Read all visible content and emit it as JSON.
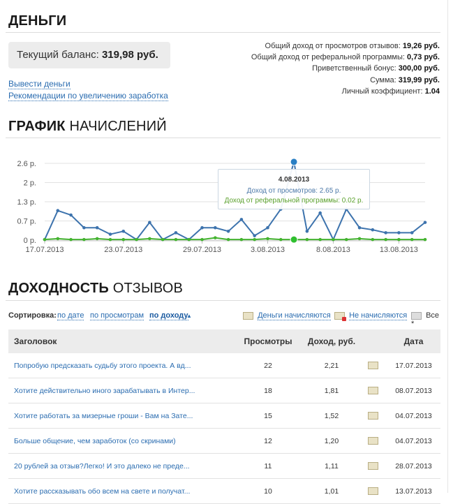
{
  "money": {
    "title": "ДЕНЬГИ",
    "balance_label": "Текущий баланс:",
    "balance_value": "319,98 руб.",
    "links": [
      "Вывести деньги",
      "Рекомендации по увеличению заработка"
    ],
    "summary": [
      {
        "label": "Общий доход от просмотров отзывов:",
        "value": "19,26 руб."
      },
      {
        "label": "Общий доход от реферальной программы:",
        "value": "0,73 руб."
      },
      {
        "label": "Приветственный бонус:",
        "value": "300,00 руб."
      },
      {
        "label": "Сумма:",
        "value": "319,99 руб."
      },
      {
        "label": "Личный коэффициент:",
        "value": "1.04"
      }
    ]
  },
  "chart_section": {
    "title_bold": "ГРАФИК",
    "title_rest": " НАЧИСЛЕНИЙ"
  },
  "chart_data": {
    "type": "line",
    "y_ticks": [
      "0 р.",
      "0.7 р.",
      "1.3 р.",
      "2 р.",
      "2.6 р."
    ],
    "y_tick_values": [
      0,
      0.65,
      1.3,
      1.95,
      2.6
    ],
    "ylim": [
      0,
      2.6
    ],
    "x_tick_labels": [
      {
        "index": 0,
        "label": "17.07.2013"
      },
      {
        "index": 6,
        "label": "23.07.2013"
      },
      {
        "index": 12,
        "label": "29.07.2013"
      },
      {
        "index": 17,
        "label": "3.08.2013"
      },
      {
        "index": 22,
        "label": "8.08.2013"
      },
      {
        "index": 27,
        "label": "13.08.2013"
      }
    ],
    "series": [
      {
        "color": "#3d73ad",
        "values": [
          0.02,
          1.0,
          0.85,
          0.42,
          0.42,
          0.2,
          0.3,
          0.02,
          0.6,
          0.02,
          0.25,
          0.02,
          0.42,
          0.42,
          0.3,
          0.7,
          0.15,
          0.42,
          1.05,
          2.65,
          0.3,
          0.92,
          0.02,
          1.05,
          0.42,
          0.35,
          0.25,
          0.25,
          0.25,
          0.6
        ]
      },
      {
        "color": "#44b330",
        "values": [
          0.02,
          0.05,
          0.02,
          0.02,
          0.05,
          0.02,
          0.02,
          0.02,
          0.05,
          0.02,
          0.02,
          0.02,
          0.02,
          0.08,
          0.02,
          0.02,
          0.02,
          0.05,
          0.02,
          0.02,
          0.02,
          0.02,
          0.02,
          0.02,
          0.05,
          0.02,
          0.02,
          0.02,
          0.02,
          0.02
        ]
      }
    ],
    "tooltip": {
      "index": 19,
      "date": "4.08.2013",
      "views_line": "Доход от просмотров: 2.65 р.",
      "ref_line": "Доход от реферальной программы: 0.02 р."
    }
  },
  "reviews": {
    "title_bold": "ДОХОДНОСТЬ",
    "title_rest": " ОТЗЫВОВ",
    "sort_label": "Сортировка:",
    "sort_options": [
      "по дате",
      "по просмотрам",
      "по доходу"
    ],
    "sort_active_arrow": "▲",
    "filters": [
      "Деньги начисляются",
      "Не начисляются",
      "Все *"
    ],
    "columns": [
      "Заголовок",
      "Просмотры",
      "Доход, руб.",
      "",
      "Дата"
    ],
    "rows": [
      {
        "title": "Попробую предсказать судьбу этого проекта. А вд...",
        "views": "22",
        "income": "2,21",
        "date": "17.07.2013"
      },
      {
        "title": "Хотите действительно иного зарабатывать в Интер...",
        "views": "18",
        "income": "1,81",
        "date": "08.07.2013"
      },
      {
        "title": "Хотите работать за мизерные гроши - Вам на Зате...",
        "views": "15",
        "income": "1,52",
        "date": "04.07.2013"
      },
      {
        "title": "Больше общение, чем заработок (со скринами)",
        "views": "12",
        "income": "1,20",
        "date": "04.07.2013"
      },
      {
        "title": "20 рублей за отзыв?Легко! И это далеко не преде...",
        "views": "11",
        "income": "1,11",
        "date": "28.07.2013"
      },
      {
        "title": "Хотите рассказывать обо всем на свете и получат...",
        "views": "10",
        "income": "1,01",
        "date": "13.07.2013"
      }
    ]
  }
}
